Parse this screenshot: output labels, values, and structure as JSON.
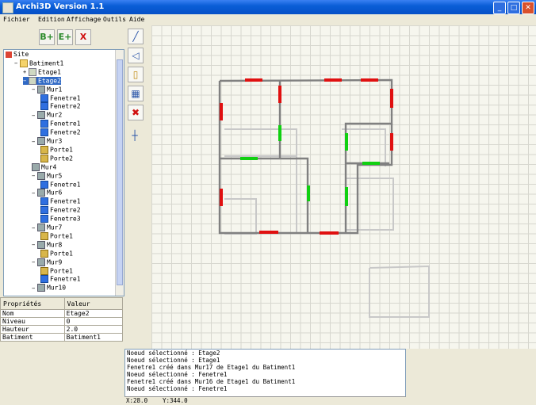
{
  "window": {
    "title": "Archi3D Version 1.1"
  },
  "menu": [
    "Fichier",
    "Edition",
    "Affichage",
    "Outils",
    "Aide"
  ],
  "toolbar": [
    {
      "icon": "add-building-icon",
      "label": "+"
    },
    {
      "icon": "add-floor-icon",
      "label": "+"
    },
    {
      "icon": "delete-icon",
      "label": "X"
    }
  ],
  "tree": [
    {
      "label": "Site",
      "icon": "site",
      "indent": 0,
      "expander": ""
    },
    {
      "label": "Batiment1",
      "icon": "bat",
      "indent": 1,
      "expander": "−"
    },
    {
      "label": "Etage1",
      "icon": "etage",
      "indent": 2,
      "expander": "+"
    },
    {
      "label": "Etage2",
      "icon": "etage",
      "indent": 2,
      "expander": "−",
      "selected": true
    },
    {
      "label": "Mur1",
      "icon": "wall",
      "indent": 3,
      "expander": "−"
    },
    {
      "label": "Fenetre1",
      "icon": "win",
      "indent": 4,
      "expander": ""
    },
    {
      "label": "Fenetre2",
      "icon": "win",
      "indent": 4,
      "expander": ""
    },
    {
      "label": "Mur2",
      "icon": "wall",
      "indent": 3,
      "expander": "−"
    },
    {
      "label": "Fenetre1",
      "icon": "win",
      "indent": 4,
      "expander": ""
    },
    {
      "label": "Fenetre2",
      "icon": "win",
      "indent": 4,
      "expander": ""
    },
    {
      "label": "Mur3",
      "icon": "wall",
      "indent": 3,
      "expander": "−"
    },
    {
      "label": "Porte1",
      "icon": "door",
      "indent": 4,
      "expander": ""
    },
    {
      "label": "Porte2",
      "icon": "door",
      "indent": 4,
      "expander": ""
    },
    {
      "label": "Mur4",
      "icon": "wall",
      "indent": 3,
      "expander": ""
    },
    {
      "label": "Mur5",
      "icon": "wall",
      "indent": 3,
      "expander": "−"
    },
    {
      "label": "Fenetre1",
      "icon": "win",
      "indent": 4,
      "expander": ""
    },
    {
      "label": "Mur6",
      "icon": "wall",
      "indent": 3,
      "expander": "−"
    },
    {
      "label": "Fenetre1",
      "icon": "win",
      "indent": 4,
      "expander": ""
    },
    {
      "label": "Fenetre2",
      "icon": "win",
      "indent": 4,
      "expander": ""
    },
    {
      "label": "Fenetre3",
      "icon": "win",
      "indent": 4,
      "expander": ""
    },
    {
      "label": "Mur7",
      "icon": "wall",
      "indent": 3,
      "expander": "−"
    },
    {
      "label": "Porte1",
      "icon": "door",
      "indent": 4,
      "expander": ""
    },
    {
      "label": "Mur8",
      "icon": "wall",
      "indent": 3,
      "expander": "−"
    },
    {
      "label": "Porte1",
      "icon": "door",
      "indent": 4,
      "expander": ""
    },
    {
      "label": "Mur9",
      "icon": "wall",
      "indent": 3,
      "expander": "−"
    },
    {
      "label": "Porte1",
      "icon": "door",
      "indent": 4,
      "expander": ""
    },
    {
      "label": "Fenetre1",
      "icon": "win",
      "indent": 4,
      "expander": ""
    },
    {
      "label": "Mur10",
      "icon": "wall",
      "indent": 3,
      "expander": "−"
    }
  ],
  "properties": {
    "headers": [
      "Propriétés",
      "Valeur"
    ],
    "rows": [
      {
        "name": "Nom",
        "value": "Etage2"
      },
      {
        "name": "Niveau",
        "value": "0"
      },
      {
        "name": "Hauteur",
        "value": "2.0"
      },
      {
        "name": "Batiment",
        "value": "Batiment1"
      }
    ]
  },
  "side_tools": [
    {
      "icon": "draw-line-icon",
      "glyph": "╱"
    },
    {
      "icon": "draw-triangle-icon",
      "glyph": "◁"
    },
    {
      "icon": "door-tool-icon",
      "glyph": "▯"
    },
    {
      "icon": "window-tool-icon",
      "glyph": "▦"
    },
    {
      "icon": "delete-tool-icon",
      "glyph": "✖"
    },
    {
      "icon": "crosshair-icon",
      "glyph": "┼"
    }
  ],
  "log": [
    "Noeud sélectionné : Etage2",
    "Noeud sélectionné : Etage1",
    "Fenetre1 créé dans Mur17 de Etage1 du Batiment1",
    "Noeud sélectionné : Fenetre1",
    "Fenetre1 créé dans Mur16 de Etage1 du Batiment1",
    "Noeud sélectionné : Fenetre1"
  ],
  "status": {
    "x": "X:28.0",
    "y": "Y:344.0"
  },
  "colors": {
    "window": "#e01010",
    "door": "#10d010",
    "wall_active": "#808080",
    "wall_ghost": "#c8c8c8"
  }
}
